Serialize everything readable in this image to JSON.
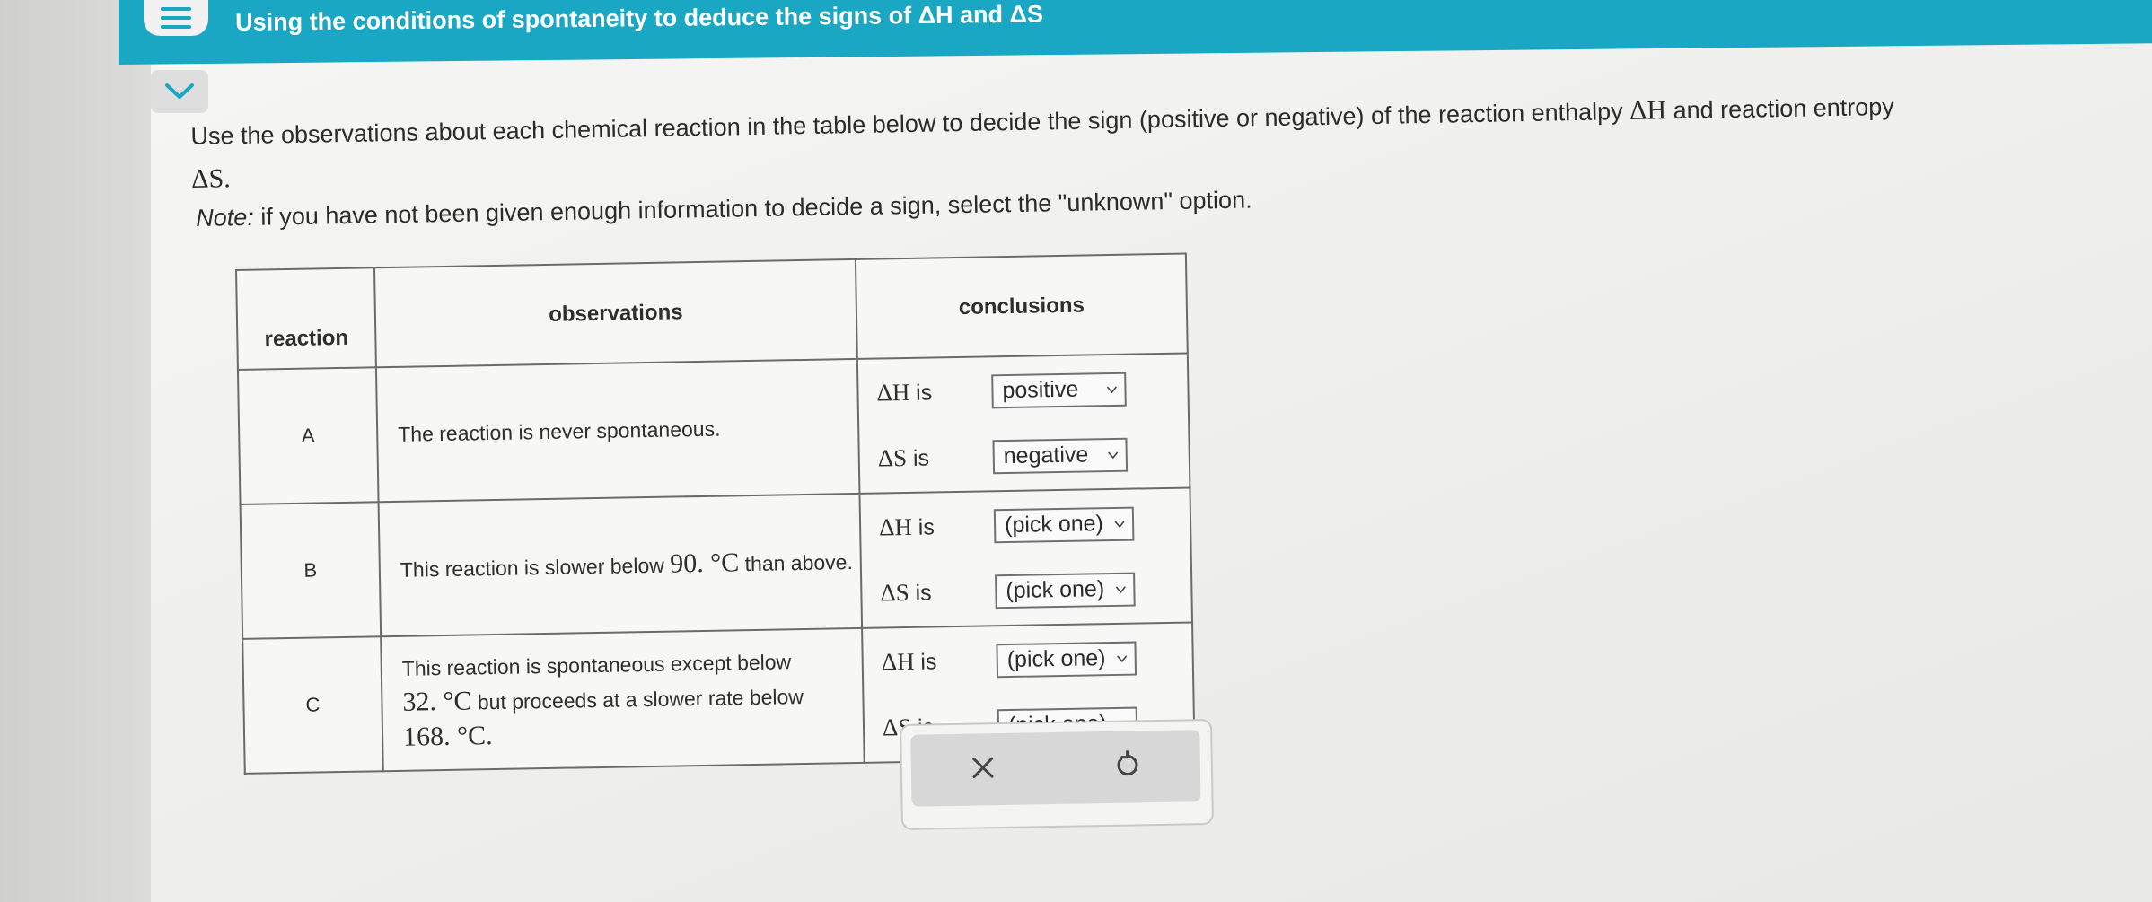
{
  "header": {
    "title": "Using the conditions of spontaneity to deduce the signs of ΔH and ΔS"
  },
  "instructions": {
    "line1": "Use the observations about each chemical reaction in the table below to decide the sign (positive or negative) of the reaction enthalpy ",
    "dH": "ΔH",
    "mid": " and reaction entropy ",
    "dS": "ΔS.",
    "note_label": "Note:",
    "note_text": " if you have not been given enough information to decide a sign, select the \"unknown\" option."
  },
  "table": {
    "headers": {
      "reaction": "reaction",
      "observations": "observations",
      "conclusions": "conclusions"
    },
    "dh_label": "ΔH",
    "ds_label": "ΔS",
    "is_word": "is",
    "rows": [
      {
        "id": "A",
        "obs": [
          "The reaction is never spontaneous."
        ],
        "dh": "positive",
        "ds": "negative"
      },
      {
        "id": "B",
        "obs": [
          "This reaction is slower below ",
          "90. °C",
          " than above."
        ],
        "dh": "(pick one)",
        "ds": "(pick one)"
      },
      {
        "id": "C",
        "obs": [
          "This reaction is spontaneous except below ",
          "32. °C",
          " but proceeds at a slower rate below ",
          "168. °C."
        ],
        "dh": "(pick one)",
        "ds": "(pick one)"
      }
    ]
  },
  "actions": {
    "clear_icon": "close-icon",
    "reset_icon": "undo-icon"
  },
  "colors": {
    "header": "#1aa7c4",
    "border": "#6b6b6b"
  }
}
